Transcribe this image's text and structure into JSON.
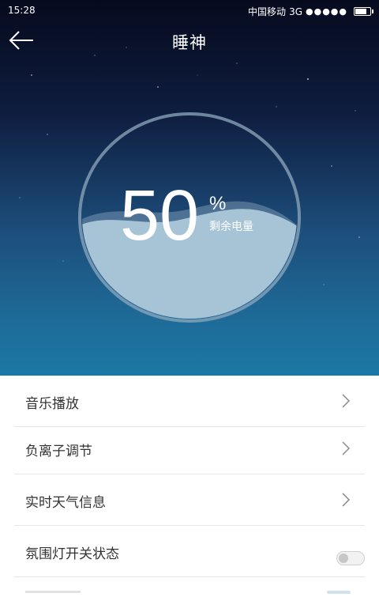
{
  "status_bar": {
    "time": "15:28",
    "carrier": "中国移动",
    "network": "3G",
    "signal_dots": "●●●●●"
  },
  "header": {
    "title": "睡神",
    "back_icon": "arrow-left-icon"
  },
  "battery": {
    "value": "50",
    "unit": "%",
    "label": "剩余电量",
    "level": 0.5
  },
  "menu": {
    "items": [
      {
        "label": "音乐播放",
        "icon": "chevron-right-icon"
      },
      {
        "label": "负离子调节",
        "icon": "chevron-right-icon"
      },
      {
        "label": "实时天气信息",
        "icon": "chevron-right-icon"
      },
      {
        "label": "氛围灯开关状态",
        "toggle": "off"
      }
    ]
  },
  "colors": {
    "sky_top": "#060a1d",
    "sky_bottom": "#1b78a4",
    "water": "#a7c4d6",
    "ring": "#8fa8be"
  }
}
